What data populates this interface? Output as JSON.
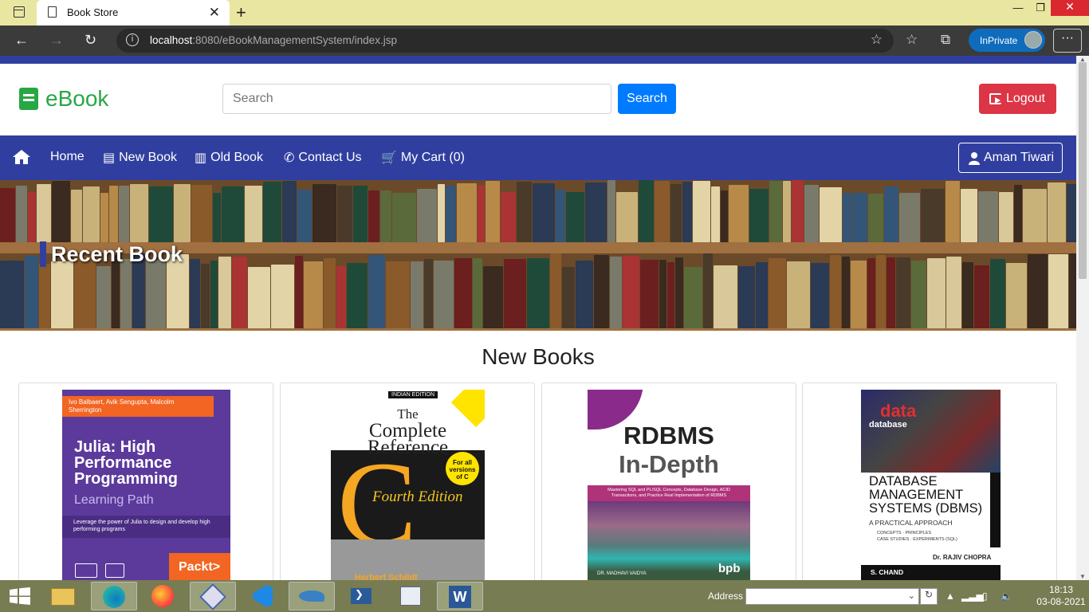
{
  "browser": {
    "tab_title": "Book Store",
    "url_host": "localhost",
    "url_rest": ":8080/eBookManagementSystem/index.jsp",
    "inprivate_label": "InPrivate"
  },
  "header": {
    "logo_text": "eBook",
    "search_placeholder": "Search",
    "search_button": "Search",
    "logout_button": "Logout"
  },
  "navbar": {
    "items": [
      {
        "label": "Home"
      },
      {
        "label": "New Book"
      },
      {
        "label": "Old Book"
      },
      {
        "label": "Contact Us"
      },
      {
        "label": "My Cart (0)"
      }
    ],
    "user_button": "Aman Tiwari"
  },
  "hero": {
    "title": "Recent Book"
  },
  "section": {
    "title": "New Books"
  },
  "books": [
    {
      "authors": "Ivo Balbaert, Avik Sengupta, Malcolm Sherrington",
      "title": "Julia: High Performance Programming",
      "subtitle": "Learning Path",
      "blurb": "Leverage the power of Julia to design and develop high performing programs",
      "publisher": "Packt>"
    },
    {
      "edition_tag": "INDIAN EDITION",
      "title_1": "The",
      "title_2": "Complete",
      "title_3": "Reference",
      "letter": "C",
      "edition": "Fourth Edition",
      "badge": "For all versions of C",
      "author": "Herbert Schildt"
    },
    {
      "title_1": "RDBMS",
      "title_2": "In-Depth",
      "tagline": "Mastering SQL and PL/SQL Concepts, Database Design, ACID Transactions, and Practice Real Implementation of RDBMS",
      "author": "DR. MADHAVI VAIDYA",
      "publisher": "bpb"
    },
    {
      "words_1": "data",
      "words_2": "database",
      "title": "DATABASE MANAGEMENT SYSTEMS (DBMS)",
      "subtitle": "A PRACTICAL APPROACH",
      "bullets": [
        "CONCEPTS",
        "PRINCIPLES",
        "CASE STUDIES",
        "EXPERIMENTS (SQL)"
      ],
      "author": "Dr. RAJIV CHOPRA",
      "publisher": "S. CHAND"
    }
  ],
  "taskbar": {
    "address_label": "Address",
    "time": "18:13",
    "date": "03-08-2021"
  },
  "colors": {
    "brand_green": "#28a745",
    "nav_blue": "#303f9f",
    "primary_blue": "#007bff",
    "danger_red": "#dc3545"
  }
}
